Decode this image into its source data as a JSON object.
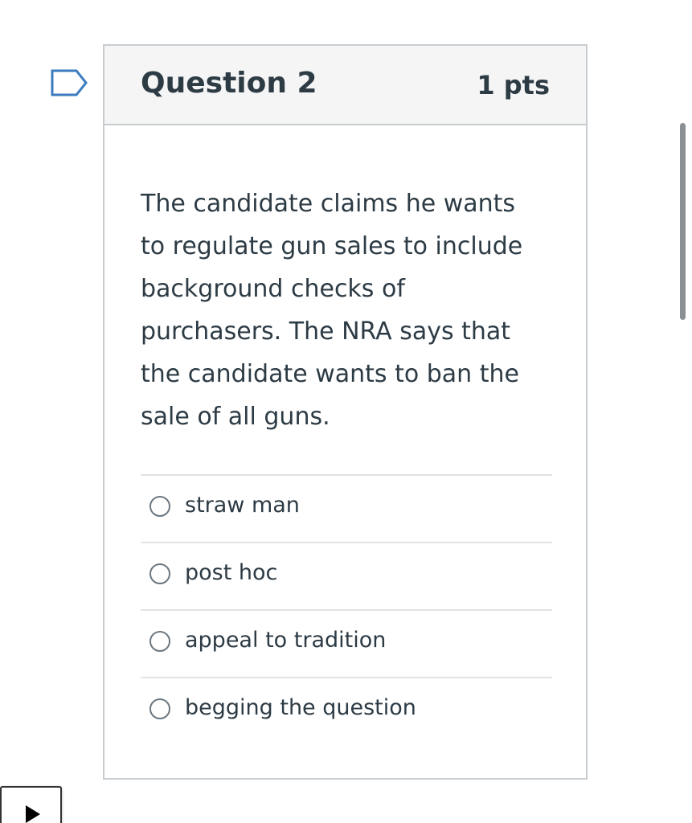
{
  "question": {
    "title": "Question 2",
    "points": "1 pts",
    "body": "The candidate claims he wants to regulate gun sales to include background checks of purchasers. The NRA says that the candidate wants to ban the sale of all guns."
  },
  "answers": [
    {
      "label": "straw man",
      "selected": false
    },
    {
      "label": "post hoc",
      "selected": false
    },
    {
      "label": "appeal to tradition",
      "selected": false
    },
    {
      "label": "begging the question",
      "selected": false
    }
  ],
  "icons": {
    "flag": "flag-icon",
    "play": "play-icon"
  },
  "colors": {
    "text": "#2d3b45",
    "header_bg": "#f5f5f5",
    "border": "#c7cdd1",
    "flag_outline": "#3b7bbf"
  }
}
